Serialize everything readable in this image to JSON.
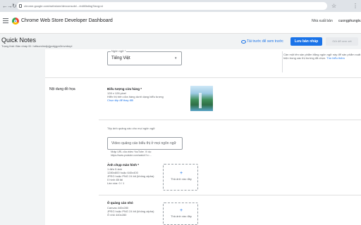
{
  "browser": {
    "url": "chrome.google.com/webstore/devconsole/.../edit/listing?lang=vi",
    "nav_back": "←",
    "nav_forward": "→",
    "nav_reload": "↻",
    "star": "☆",
    "menu": "⋮"
  },
  "appbar": {
    "title": "Chrome Web Store Developer Dashboard",
    "publisher": "Nhà xuất bản",
    "account": "cuongphungtv..."
  },
  "item": {
    "name": "Quick Notes",
    "status": "Trạng thái: Bản nháp   ID: hdfaomlmdjcjjpokjgpn3mvnbnpl"
  },
  "actions": {
    "preview": "Tải trước để xem trước",
    "submit": "Lưu bản nháp",
    "save": "Gửi để xem xét"
  },
  "language": {
    "legend": "Ngôn ngữ *",
    "value": "Tiếng Việt",
    "caret": "▾",
    "info": "Cần một tên sản phẩm bằng ngôn ngữ này để sản phẩm xuất hiện trong các thị trường đã chọn.",
    "info_link": "Tìm hiểu thêm"
  },
  "graphic_assets": {
    "section_label": "Nội dung đồ họa",
    "store_icon_title": "Biểu tượng cửa hàng *",
    "store_icon_size": "128 x 128 pixel",
    "store_icon_note": "Hiển thị trên cửa hàng dưới dạng biểu tượng",
    "store_icon_link": "Chọn tệp để thay đổi"
  },
  "promo": {
    "desc_label": "Tệp ảnh quảng cáo cho mọi ngôn ngữ",
    "placeholder": "Video quảng cáo biểu thị ở mọi ngôn ngữ",
    "help": "Nhập URL của video YouTube. Ví dụ: https://www.youtube.com/watch?v=..."
  },
  "screenshots": {
    "title": "Ảnh chụp màn hình *",
    "lines": [
      "1 đến 5 ảnh",
      "1280x800 hoặc 640x400",
      "JPEG hoặc PNG 24 bit (không alpha)",
      "0 hình đã tải",
      "Lần xóa: 0 / 1"
    ],
    "drop_label": "Thả ảnh vào đây",
    "plus": "+"
  },
  "small_promo": {
    "title": "Ô quảng cáo nhỏ",
    "lines": [
      "Canvas 440x280",
      "JPEG hoặc PNG 24 bit (không alpha)",
      "Ô nhỏ 440x280"
    ],
    "drop_label": "Thả ảnh vào đây",
    "plus": "+"
  }
}
